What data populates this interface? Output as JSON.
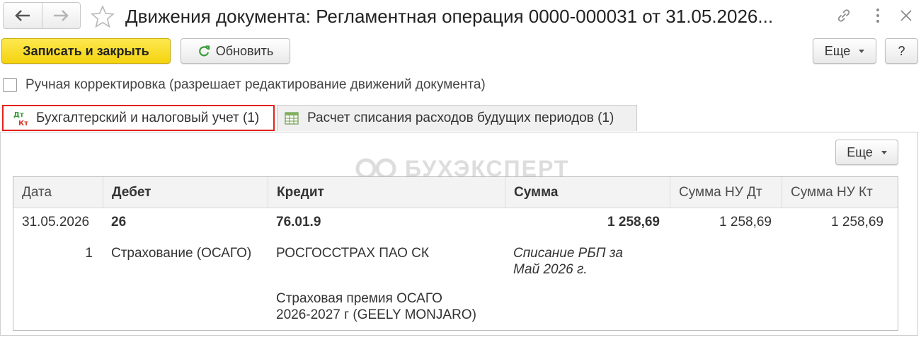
{
  "window": {
    "title": "Движения документа: Регламентная операция 0000-000031 от 31.05.2026..."
  },
  "toolbar": {
    "save_close_label": "Записать и закрыть",
    "refresh_label": "Обновить",
    "more_label": "Еще",
    "help_label": "?"
  },
  "manual_correction": {
    "label": "Ручная корректировка (разрешает редактирование движений документа)",
    "checked": false
  },
  "tabs": [
    {
      "label": "Бухгалтерский и налоговый учет (1)",
      "icon": "dt-kt-icon",
      "active": true
    },
    {
      "label": "Расчет списания расходов будущих периодов (1)",
      "icon": "table-grid-icon",
      "active": false
    }
  ],
  "panel": {
    "more_label": "Еще"
  },
  "watermark": "БУХЭКСПЕРТ",
  "table": {
    "columns": [
      "Дата",
      "Дебет",
      "Кредит",
      "Сумма",
      "Сумма НУ Дт",
      "Сумма НУ Кт"
    ],
    "row": {
      "date": "31.05.2026",
      "line_no": "1",
      "debit_account": "26",
      "debit_subconto": "Страхование (ОСАГО)",
      "credit_account": "76.01.9",
      "credit_subconto_1": "РОСГОССТРАХ ПАО СК",
      "credit_subconto_2_line1": "Страховая премия ОСАГО",
      "credit_subconto_2_line2": "2026-2027 г (GEELY MONJARO)",
      "amount": "1 258,69",
      "content_line1": "Списание РБП за",
      "content_line2": "Май 2026 г.",
      "amount_nu_dt": "1 258,69",
      "amount_nu_kt": "1 258,69"
    }
  },
  "colors": {
    "primary_button": "#f5d30f",
    "active_tab_border": "#e2231a"
  }
}
